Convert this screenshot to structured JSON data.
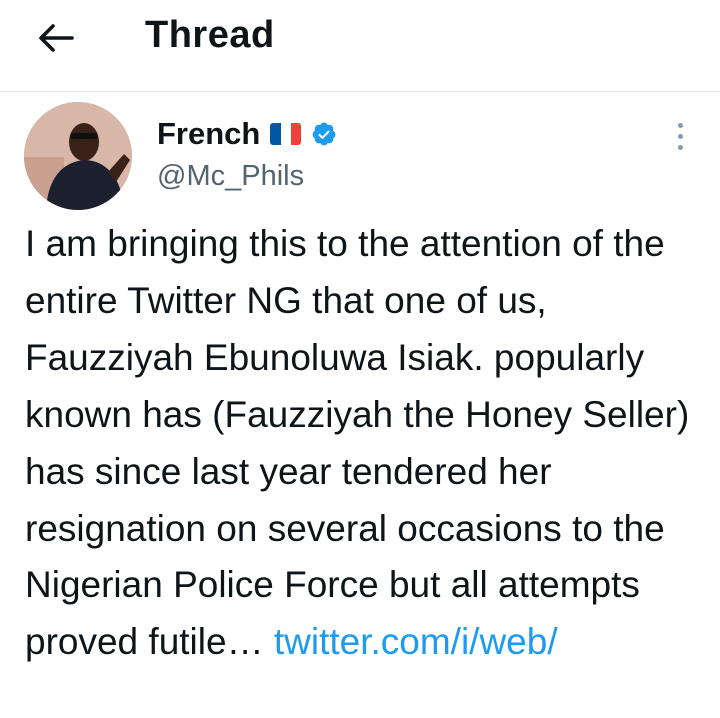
{
  "header": {
    "title": "Thread",
    "back_icon": "arrow-left-icon"
  },
  "tweet": {
    "author": {
      "display_name": "French",
      "flag_icon": "france-flag-icon",
      "verified_icon": "verified-badge-icon",
      "handle": "@Mc_Phils"
    },
    "more_icon": "more-vertical-icon",
    "text": "I am bringing this to the attention of the entire Twitter NG that one of us, Fauzziyah Ebunoluwa Isiak. popularly known has (Fauzziyah the Honey Seller) has since last year tendered her resignation on several occasions to the Nigerian Police Force but all attempts proved futile…",
    "link_text": "twitter.com/i/web/"
  },
  "colors": {
    "text": "#0f1419",
    "secondary": "#536471",
    "link": "#1d9bf0",
    "divider": "#e6e9ec",
    "verified": "#1d9bf0",
    "flag_blue": "#0055a4",
    "flag_white": "#ffffff",
    "flag_red": "#ef4135"
  }
}
